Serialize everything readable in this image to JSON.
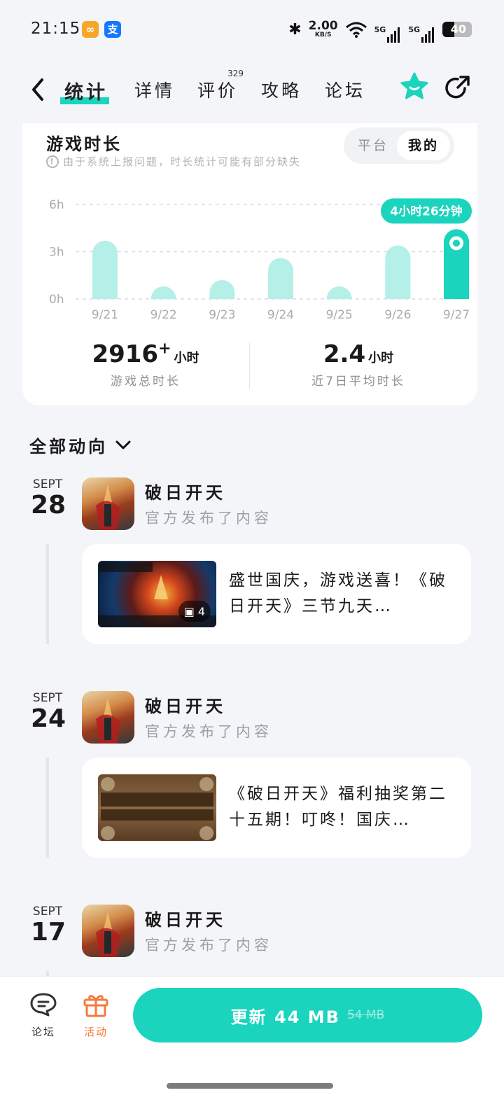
{
  "status": {
    "time": "21:15",
    "rate_value": "2.00",
    "rate_unit": "KB/S",
    "net1": "5G",
    "net2": "5G",
    "battery": "40",
    "battery_level": 0.4
  },
  "nav": {
    "tabs": [
      {
        "label": "统计",
        "active": true
      },
      {
        "label": "详情"
      },
      {
        "label": "评价",
        "badge": "329"
      },
      {
        "label": "攻略"
      },
      {
        "label": "论坛"
      }
    ]
  },
  "stats": {
    "title": "游戏时长",
    "notice": "由于系统上报问题，时长统计可能有部分缺失",
    "segment": [
      "平台",
      "我的"
    ],
    "total_value": "2916",
    "total_plus": "+",
    "total_unit": "小时",
    "total_label": "游戏总时长",
    "avg_value": "2.4",
    "avg_unit": "小时",
    "avg_label": "近7日平均时长",
    "tooltip": "4小时26分钟"
  },
  "chart_data": {
    "type": "bar",
    "categories": [
      "9/21",
      "9/22",
      "9/23",
      "9/24",
      "9/25",
      "9/26",
      "9/27"
    ],
    "values": [
      3.7,
      0.8,
      1.2,
      2.6,
      0.8,
      3.4,
      4.43
    ],
    "y_ticks": [
      "0h",
      "3h",
      "6h"
    ],
    "ylim": [
      0,
      6
    ],
    "highlight_index": 6,
    "colors": {
      "bar": "#b4f0e8",
      "highlight": "#1ad4bd",
      "grid": "#d8dadd",
      "tick": "#a8adb3"
    }
  },
  "section": {
    "title": "全部动向"
  },
  "feed": [
    {
      "month": "SEPT",
      "day": "28",
      "app": "破日开天",
      "sub": "官方发布了内容",
      "text": "盛世国庆，游戏送喜！《破日开天》三节九天…",
      "img_count": "4",
      "img_style": "fire"
    },
    {
      "month": "SEPT",
      "day": "24",
      "app": "破日开天",
      "sub": "官方发布了内容",
      "text": "《破日开天》福利抽奖第二十五期！叮咚！国庆…",
      "img_style": "lottery"
    },
    {
      "month": "SEPT",
      "day": "17",
      "app": "破日开天",
      "sub": "官方发布了内容"
    }
  ],
  "bottom": {
    "forum": "论坛",
    "activity": "活动",
    "update": "更新 44 MB",
    "old_size": "54 MB"
  }
}
